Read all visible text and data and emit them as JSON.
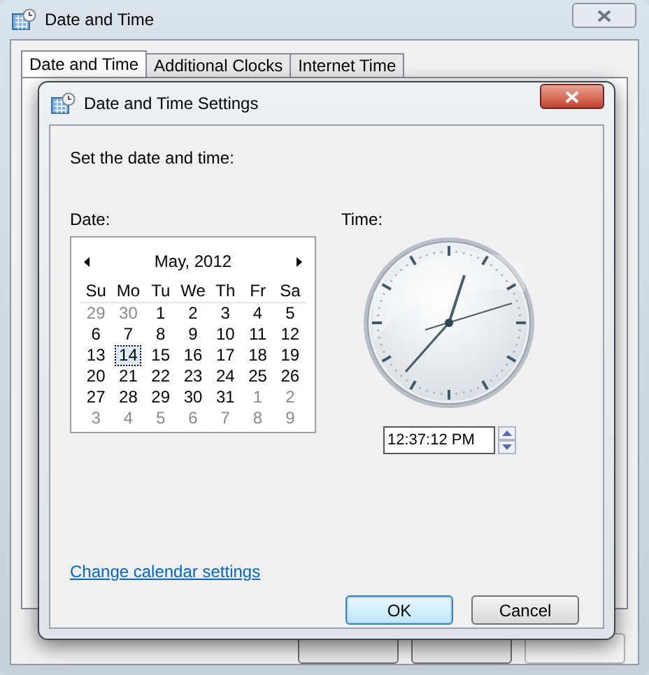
{
  "window": {
    "title": "Date and Time"
  },
  "tabs": [
    {
      "label": "Date and Time",
      "selected": true
    },
    {
      "label": "Additional Clocks",
      "selected": false
    },
    {
      "label": "Internet Time",
      "selected": false
    }
  ],
  "dialog": {
    "title": "Date and Time Settings",
    "instruction": "Set the date and time:",
    "date_label": "Date:",
    "time_label": "Time:",
    "calendar": {
      "month": "May, 2012",
      "weekdays": [
        "Su",
        "Mo",
        "Tu",
        "We",
        "Th",
        "Fr",
        "Sa"
      ],
      "days": [
        {
          "text": "29",
          "kind": "other",
          "selected": false
        },
        {
          "text": "30",
          "kind": "other",
          "selected": false
        },
        {
          "text": "1",
          "kind": "current",
          "selected": false
        },
        {
          "text": "2",
          "kind": "current",
          "selected": false
        },
        {
          "text": "3",
          "kind": "current",
          "selected": false
        },
        {
          "text": "4",
          "kind": "current",
          "selected": false
        },
        {
          "text": "5",
          "kind": "current",
          "selected": false
        },
        {
          "text": "6",
          "kind": "current",
          "selected": false
        },
        {
          "text": "7",
          "kind": "current",
          "selected": false
        },
        {
          "text": "8",
          "kind": "current",
          "selected": false
        },
        {
          "text": "9",
          "kind": "current",
          "selected": false
        },
        {
          "text": "10",
          "kind": "current",
          "selected": false
        },
        {
          "text": "11",
          "kind": "current",
          "selected": false
        },
        {
          "text": "12",
          "kind": "current",
          "selected": false
        },
        {
          "text": "13",
          "kind": "current",
          "selected": false
        },
        {
          "text": "14",
          "kind": "current",
          "selected": true
        },
        {
          "text": "15",
          "kind": "current",
          "selected": false
        },
        {
          "text": "16",
          "kind": "current",
          "selected": false
        },
        {
          "text": "17",
          "kind": "current",
          "selected": false
        },
        {
          "text": "18",
          "kind": "current",
          "selected": false
        },
        {
          "text": "19",
          "kind": "current",
          "selected": false
        },
        {
          "text": "20",
          "kind": "current",
          "selected": false
        },
        {
          "text": "21",
          "kind": "current",
          "selected": false
        },
        {
          "text": "22",
          "kind": "current",
          "selected": false
        },
        {
          "text": "23",
          "kind": "current",
          "selected": false
        },
        {
          "text": "24",
          "kind": "current",
          "selected": false
        },
        {
          "text": "25",
          "kind": "current",
          "selected": false
        },
        {
          "text": "26",
          "kind": "current",
          "selected": false
        },
        {
          "text": "27",
          "kind": "current",
          "selected": false
        },
        {
          "text": "28",
          "kind": "current",
          "selected": false
        },
        {
          "text": "29",
          "kind": "current",
          "selected": false
        },
        {
          "text": "30",
          "kind": "current",
          "selected": false
        },
        {
          "text": "31",
          "kind": "current",
          "selected": false
        },
        {
          "text": "1",
          "kind": "other",
          "selected": false
        },
        {
          "text": "2",
          "kind": "other",
          "selected": false
        },
        {
          "text": "3",
          "kind": "other",
          "selected": false
        },
        {
          "text": "4",
          "kind": "other",
          "selected": false
        },
        {
          "text": "5",
          "kind": "other",
          "selected": false
        },
        {
          "text": "6",
          "kind": "other",
          "selected": false
        },
        {
          "text": "7",
          "kind": "other",
          "selected": false
        },
        {
          "text": "8",
          "kind": "other",
          "selected": false
        },
        {
          "text": "9",
          "kind": "other",
          "selected": false
        }
      ]
    },
    "time_value": "12:37:12 PM",
    "link": "Change calendar settings",
    "buttons": [
      "OK",
      "Cancel"
    ]
  }
}
